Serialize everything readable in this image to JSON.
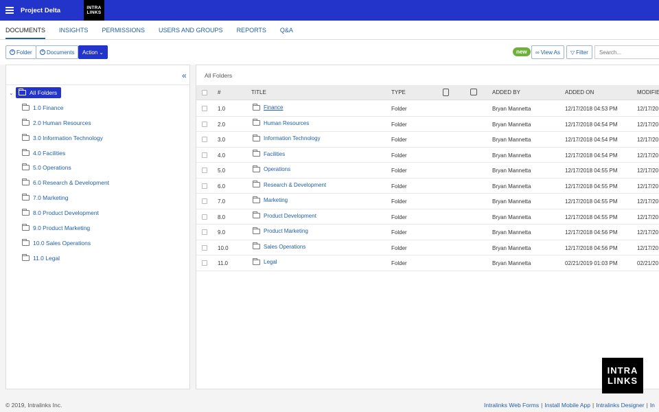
{
  "header": {
    "app_title": "Project Delta",
    "logo_line1": "INTRA",
    "logo_line2": "LINKS"
  },
  "nav": {
    "tabs": [
      "DOCUMENTS",
      "INSIGHTS",
      "PERMISSIONS",
      "USERS AND GROUPS",
      "REPORTS",
      "Q&A"
    ],
    "active": "DOCUMENTS"
  },
  "toolbar": {
    "folder_label": "Folder",
    "documents_label": "Documents",
    "action_label": "Action",
    "new_badge": "new",
    "view_as_label": "View As",
    "filter_label": "Filter",
    "search_placeholder": "Search..."
  },
  "tree": {
    "root": "All Folders",
    "items": [
      "1.0 Finance",
      "2.0 Human Resources",
      "3.0 Information Technology",
      "4.0 Facilities",
      "5.0 Operations",
      "6.0 Research & Development",
      "7.0 Marketing",
      "8.0 Product Development",
      "9.0 Product Marketing",
      "10.0 Sales Operations",
      "11.0 Legal"
    ]
  },
  "main": {
    "breadcrumb": "All Folders",
    "columns": {
      "num": "#",
      "title": "TITLE",
      "type": "TYPE",
      "added_by": "ADDED BY",
      "added_on": "ADDED ON",
      "modified": "MODIFIE"
    },
    "rows": [
      {
        "num": "1.0",
        "title": "Finance",
        "type": "Folder",
        "added_by": "Bryan Mannetta",
        "added_on": "12/17/2018 04:53 PM",
        "modified": "12/17/20"
      },
      {
        "num": "2.0",
        "title": "Human Resources",
        "type": "Folder",
        "added_by": "Bryan Mannetta",
        "added_on": "12/17/2018 04:54 PM",
        "modified": "12/17/20"
      },
      {
        "num": "3.0",
        "title": "Information Technology",
        "type": "Folder",
        "added_by": "Bryan Mannetta",
        "added_on": "12/17/2018 04:54 PM",
        "modified": "12/17/20"
      },
      {
        "num": "4.0",
        "title": "Facilities",
        "type": "Folder",
        "added_by": "Bryan Mannetta",
        "added_on": "12/17/2018 04:54 PM",
        "modified": "12/17/20"
      },
      {
        "num": "5.0",
        "title": "Operations",
        "type": "Folder",
        "added_by": "Bryan Mannetta",
        "added_on": "12/17/2018 04:55 PM",
        "modified": "12/17/20"
      },
      {
        "num": "6.0",
        "title": "Research & Development",
        "type": "Folder",
        "added_by": "Bryan Mannetta",
        "added_on": "12/17/2018 04:55 PM",
        "modified": "12/17/20"
      },
      {
        "num": "7.0",
        "title": "Marketing",
        "type": "Folder",
        "added_by": "Bryan Mannetta",
        "added_on": "12/17/2018 04:55 PM",
        "modified": "12/17/20"
      },
      {
        "num": "8.0",
        "title": "Product Development",
        "type": "Folder",
        "added_by": "Bryan Mannetta",
        "added_on": "12/17/2018 04:55 PM",
        "modified": "12/17/20"
      },
      {
        "num": "9.0",
        "title": "Product Marketing",
        "type": "Folder",
        "added_by": "Bryan Mannetta",
        "added_on": "12/17/2018 04:56 PM",
        "modified": "12/17/20"
      },
      {
        "num": "10.0",
        "title": "Sales Operations",
        "type": "Folder",
        "added_by": "Bryan Mannetta",
        "added_on": "12/17/2018 04:56 PM",
        "modified": "12/17/20"
      },
      {
        "num": "11.0",
        "title": "Legal",
        "type": "Folder",
        "added_by": "Bryan Mannetta",
        "added_on": "02/21/2019 01:03 PM",
        "modified": "02/21/20"
      }
    ]
  },
  "watermark": {
    "line1": "INTRA",
    "line2": "LINKS"
  },
  "footer": {
    "copyright": "© 2019, Intralinks Inc.",
    "links": [
      "Intralinks Web Forms",
      "Install Mobile App",
      "Intralinks Designer",
      "In"
    ]
  },
  "colors": {
    "brand": "#2234c9",
    "link": "#1f5fa8",
    "new_badge": "#6fb03a"
  }
}
